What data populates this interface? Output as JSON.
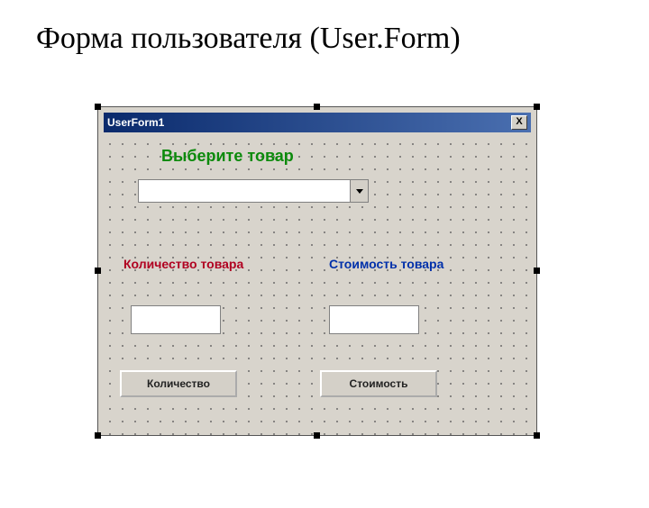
{
  "slide": {
    "title": "Форма пользователя (User.Form)"
  },
  "form": {
    "titlebar": "UserForm1",
    "close_symbol": "X",
    "heading": "Выберите товар",
    "combo_value": "",
    "qty_label": "Количество товара",
    "cost_label": "Стоимость товара",
    "qty_value": "",
    "cost_value": "",
    "qty_button": "Количество",
    "cost_button": "Стоимость"
  }
}
